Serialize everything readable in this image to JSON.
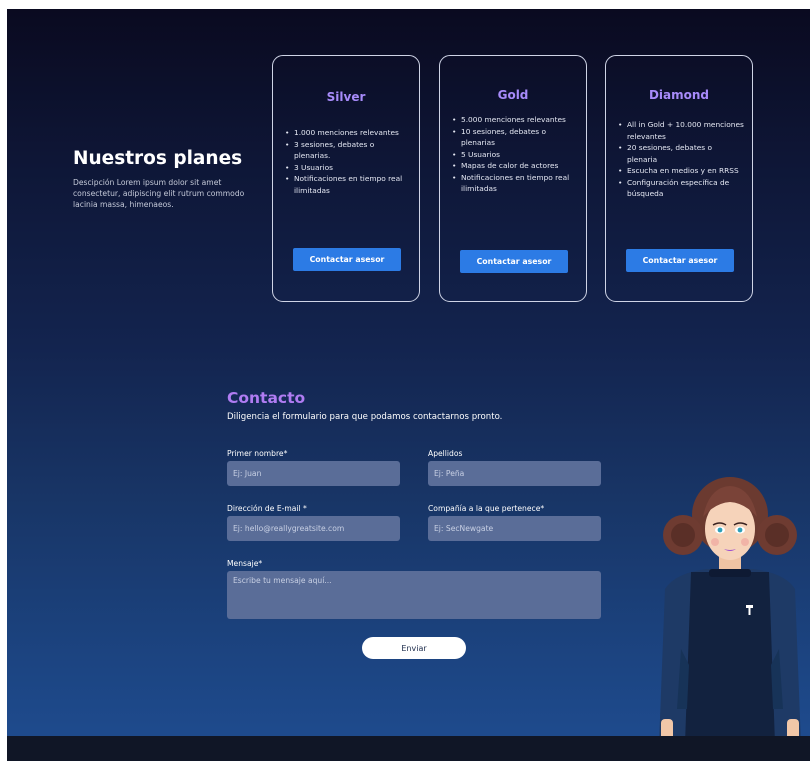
{
  "plans": {
    "title": "Nuestros planes",
    "description": "Descipción Lorem ipsum dolor sit amet consectetur, adipiscing elit rutrum commodo lacinia massa, himenaeos.",
    "cards": [
      {
        "name": "Silver",
        "features": [
          "1.000 menciones relevantes",
          "3 sesiones, debates o plenarias.",
          "3 Usuarios",
          "Notificaciones en tiempo real ilimitadas"
        ],
        "button": "Contactar asesor"
      },
      {
        "name": "Gold",
        "features": [
          "5.000 menciones relevantes",
          "10 sesiones, debates o plenarias",
          "5 Usuarios",
          "Mapas de calor de actores",
          "Notificaciones en tiempo real ilimitadas"
        ],
        "button": "Contactar asesor"
      },
      {
        "name": "Diamond",
        "features": [
          "All in Gold + 10.000 menciones relevantes",
          "20 sesiones, debates o plenaria",
          "Escucha en medios y en RRSS",
          "Configuración específica de búsqueda"
        ],
        "button": "Contactar asesor"
      }
    ]
  },
  "contact": {
    "title": "Contacto",
    "subtitle": "Diligencia el formulario para que podamos contactarnos pronto.",
    "fields": {
      "first_name": {
        "label": "Primer nombre*",
        "placeholder": "Ej: Juan"
      },
      "last_name": {
        "label": "Apellidos",
        "placeholder": "Ej: Peña"
      },
      "email": {
        "label": "Dirección de E-mail *",
        "placeholder": "Ej: hello@reallygreatsite.com"
      },
      "company": {
        "label": "Compañía a la que pertenece*",
        "placeholder": "Ej: SecNewgate"
      },
      "message": {
        "label": "Mensaje*",
        "placeholder": "Escribe tu mensaje aquí..."
      }
    },
    "submit": "Enviar"
  },
  "colors": {
    "accent_purple": "#a78bfa",
    "button_blue": "#2c7be5",
    "input_bg": "#5a6d98"
  },
  "icons": {
    "avatar": "cartoon-woman-avatar"
  }
}
